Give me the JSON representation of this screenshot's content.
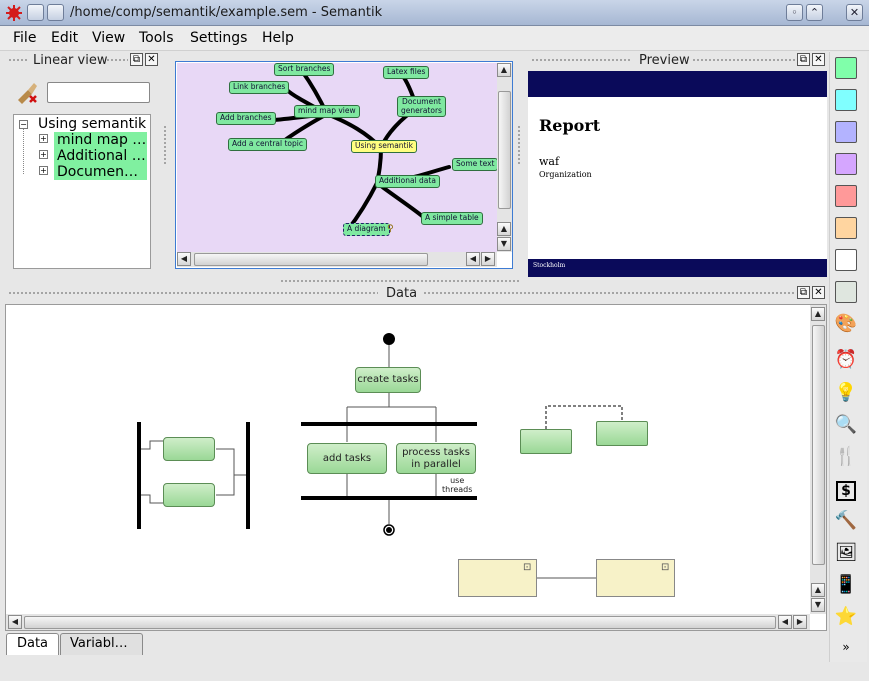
{
  "window": {
    "title": "/home/comp/semantik/example.sem  - Semantik",
    "buttons": {
      "minimize": "_",
      "maximize": "□",
      "close": "✕"
    }
  },
  "menu": [
    "File",
    "Edit",
    "View",
    "Tools",
    "Settings",
    "Help"
  ],
  "linear_view": {
    "title": "Linear view",
    "filter_value": "",
    "tree": {
      "root": "Using semantik",
      "children": [
        "mind map …",
        "Additional …",
        "Documen…"
      ]
    }
  },
  "mindmap": {
    "nodes": [
      {
        "id": "root",
        "label": "Using semantik",
        "color": "#ffff80"
      },
      {
        "id": "mmv",
        "label": "mind map view"
      },
      {
        "id": "sb",
        "label": "Sort branches"
      },
      {
        "id": "lb",
        "label": "Link branches"
      },
      {
        "id": "ab",
        "label": "Add branches"
      },
      {
        "id": "act",
        "label": "Add a central topic"
      },
      {
        "id": "lf",
        "label": "Latex files"
      },
      {
        "id": "dg",
        "label": "Document\ngenerators"
      },
      {
        "id": "ad",
        "label": "Additional data"
      },
      {
        "id": "st",
        "label": "Some text"
      },
      {
        "id": "ast",
        "label": "A simple table"
      },
      {
        "id": "adg",
        "label": "A diagram",
        "selected": true
      }
    ]
  },
  "preview": {
    "title": "Preview",
    "report_title": "Report",
    "author": "waf",
    "organization": "Organization",
    "footer": "Stockholm",
    "colors": {
      "band": "#0a0a5a"
    }
  },
  "data_panel": {
    "title": "Data",
    "diagram": {
      "create": "create tasks",
      "add": "add tasks",
      "process": "process tasks\nin parallel",
      "note": "use\nthreads"
    }
  },
  "tabs": [
    "Data",
    "Variabl…"
  ],
  "palette": {
    "swatches": [
      "#80ffaa",
      "#80ffff",
      "#b3b3ff",
      "#d5a6ff",
      "#ff9999",
      "#ffd5a0",
      "#ffffff",
      "#dfe6df"
    ],
    "icons": [
      "palette-icon",
      "alarm-clock-icon",
      "lightbulb-icon",
      "magnifier-icon",
      "cutlery-icon",
      "dollar-icon",
      "gavel-icon",
      "portrait-icon",
      "phone-icon",
      "star-icon",
      "more-icon"
    ]
  }
}
